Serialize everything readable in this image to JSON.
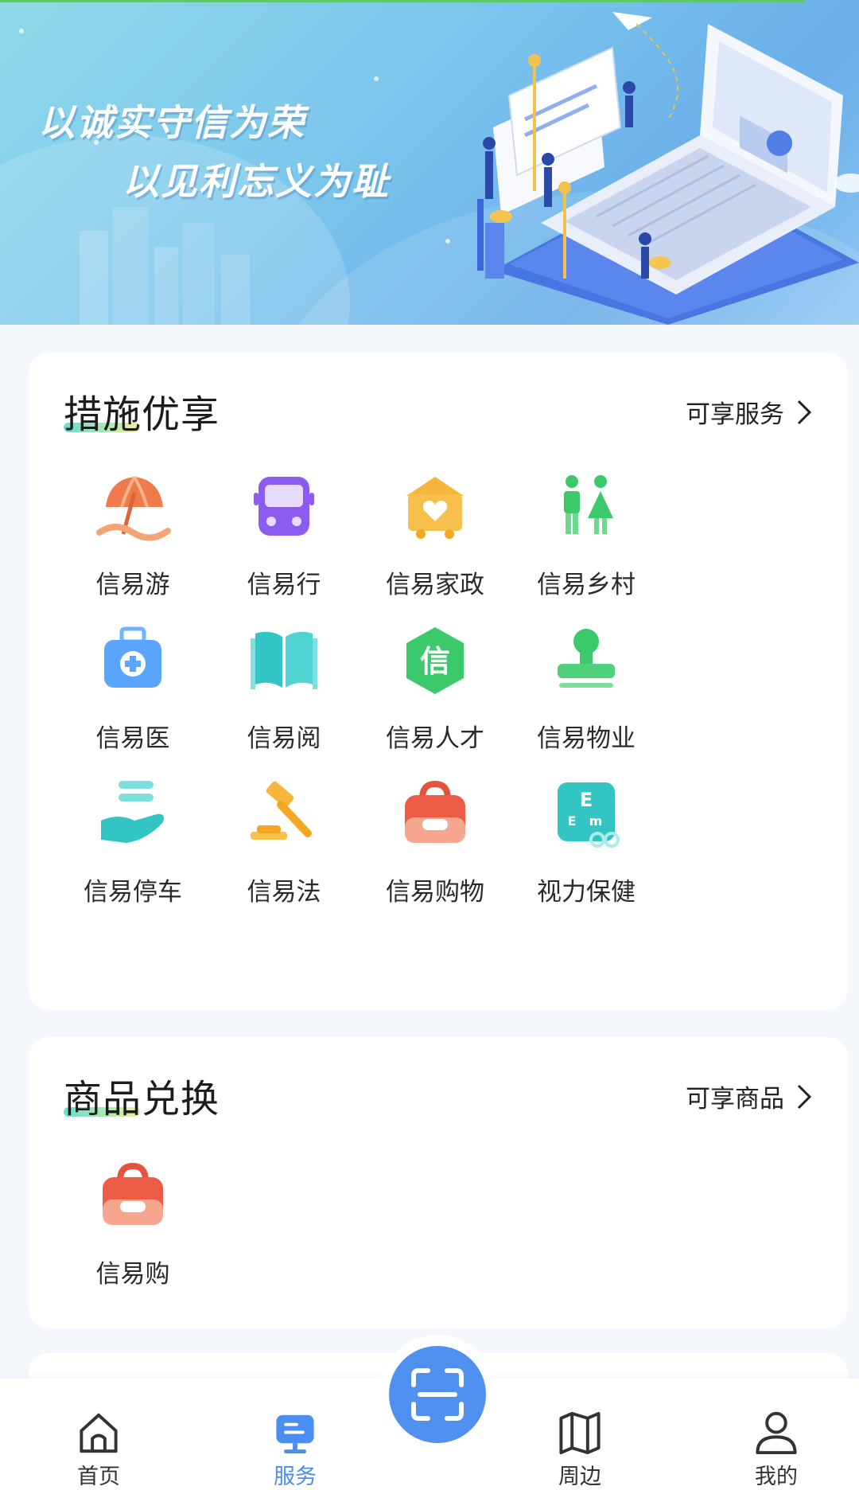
{
  "banner": {
    "slogan_line1": "以诚实守信为荣",
    "slogan_line2": "以见利忘义为耻"
  },
  "sections": [
    {
      "title": "措施优享",
      "more_label": "可享服务",
      "items": [
        {
          "label": "信易游",
          "icon": "beach-umbrella-icon"
        },
        {
          "label": "信易行",
          "icon": "bus-icon"
        },
        {
          "label": "信易家政",
          "icon": "home-heart-icon"
        },
        {
          "label": "信易乡村",
          "icon": "villagers-icon"
        },
        {
          "label": "信易医",
          "icon": "medical-kit-icon"
        },
        {
          "label": "信易阅",
          "icon": "open-book-icon"
        },
        {
          "label": "信易人才",
          "icon": "credit-hexagon-icon"
        },
        {
          "label": "信易物业",
          "icon": "stamp-icon"
        },
        {
          "label": "信易停车",
          "icon": "hand-parking-icon"
        },
        {
          "label": "信易法",
          "icon": "gavel-icon"
        },
        {
          "label": "信易购物",
          "icon": "shopping-bag-icon"
        },
        {
          "label": "视力保健",
          "icon": "eye-chart-icon"
        }
      ]
    },
    {
      "title": "商品兑换",
      "more_label": "可享商品",
      "items": [
        {
          "label": "信易购",
          "icon": "shopping-bag-icon"
        }
      ]
    }
  ],
  "tabbar": {
    "items": [
      {
        "label": "首页",
        "icon": "home-icon",
        "active": false
      },
      {
        "label": "服务",
        "icon": "service-icon",
        "active": true
      },
      {
        "label": "周边",
        "icon": "map-icon",
        "active": false
      },
      {
        "label": "我的",
        "icon": "user-icon",
        "active": false
      }
    ],
    "scan_icon": "scan-icon"
  },
  "colors": {
    "accent": "#4f90f0",
    "active_tab": "#4b8ef1",
    "page_bg": "#f4f7fc"
  }
}
